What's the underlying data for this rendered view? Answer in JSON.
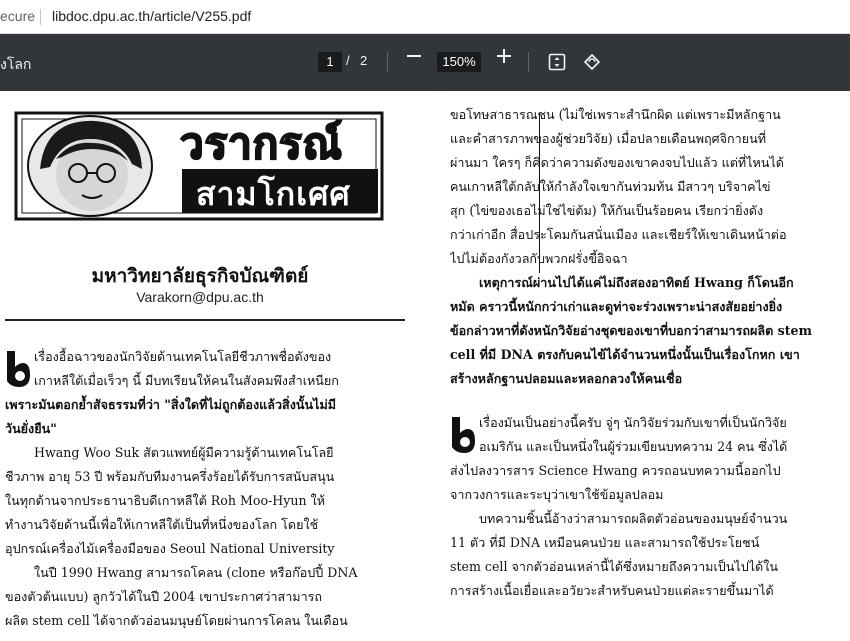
{
  "browser": {
    "secure_label": "ecure",
    "url": "libdoc.dpu.ac.th/article/V255.pdf"
  },
  "toolbar": {
    "title": "งโลก",
    "current_page": "1",
    "page_separator": "/",
    "total_pages": "2",
    "zoom": "150%",
    "icons": [
      "minus-icon",
      "plus-icon",
      "fit-page-icon",
      "rotate-icon"
    ]
  },
  "article": {
    "logo_line1": "วรากรณ์",
    "logo_line2": "สามโกเศศ",
    "university": "มหาวิทยาลัยธุรกิจบัณฑิตย์",
    "email": "Varakorn@dpu.ac.th",
    "left_column": [
      "เรื่องอื้อฉาวของนักวิจัยด้านเทคโนโลยีชีวภาพชื่อดังของ",
      "เกาหลีใต้เมื่อเร็วๆ นี้ มีบทเรียนให้คนในสังคมพึงสำเหนียก",
      "เพราะมันตอกย้ำสัจธรรมที่ว่า \"สิ่งใดที่ไม่ถูกต้องแล้วสิ่งนั้นไม่มี",
      "วันยั่งยืน\"",
      "Hwang Woo Suk สัตวแพทย์ผู้มีความรู้ด้านเทคโนโลยี",
      "ชีวภาพ อายุ 53 ปี พร้อมกับทีมงานครึ่งร้อยได้รับการสนับสนุน",
      "ในทุกด้านจากประธานาธิบดีเกาหลีใต้ Roh Moo-Hyun ให้",
      "ทำงานวิจัยด้านนี้เพื่อให้เกาหลีใต้เป็นที่หนึ่งของโลก โดยใช้",
      "อุปกรณ์เครื่องไม้เครื่องมือของ Seoul National University",
      "ในปี 1990 Hwang สามารถโคลน (clone หรือก๊อปปี้ DNA",
      "ของตัวต้นแบบ) ลูกวัวได้ในปี 2004 เขาประกาศว่าสามารถ",
      "ผลิต stem cell ได้จากตัวอ่อนมนุษย์โดยผ่านการโคลน ในเดือน"
    ],
    "right_column": [
      "ขอโทษสาธารณชน (ไม่ใช่เพราะสำนึกผิด แต่เพราะมีหลักฐาน",
      "และคำสารภาพของผู้ช่วยวิจัย) เมื่อปลายเดือนพฤศจิกายนที่",
      "ผ่านมา ใครๆ ก็คิดว่าความดังของเขาคงจบไปแล้ว แต่ที่ไหนได้",
      "คนเกาหลีใต้กลับให้กำลังใจเขากันท่วมท้น มีสาวๆ บริจาคไข่",
      "สุก (ไข่ของเธอไม่ใช่ไข่ต้ม) ให้กันเป็นร้อยคน เรียกว่ายิ่งดัง",
      "กว่าเก่าอีก สื่อประโคมกันสนั่นเมือง และเชียร์ให้เขาเดินหน้าต่อ",
      "ไปไม่ต้องกังวลกับพวกฝรั่งขี้อิจฉา",
      "เหตุการณ์ผ่านไปได้แค่ไม่ถึงสองอาทิตย์ Hwang ก็โดนอีก",
      "หมัด คราวนี้หนักกว่าเก่าและดูท่าจะร่วงเพราะน่าสงสัยอย่างยิ่ง",
      "ข้อกล่าวหาที่ดังหนักวิจัยอ่างชุดของเขาที่บอกว่าสามารถผลิต stem",
      "cell ที่มี DNA ตรงกับคนไข้ได้จำนวนหนึ่งนั้นเป็นเรื่องโกหก เขา",
      "สร้างหลักฐานปลอมและหลอกลวงให้คนเชื่อ",
      "เรื่องมันเป็นอย่างนี้ครับ จู่ๆ นักวิจัยร่วมกับเขาที่เป็นนักวิจัย",
      "อเมริกัน และเป็นหนึ่งในผู้ร่วมเขียนบทความ 24 คน ซึ่งได้",
      "ส่งไปลงวารสาร Science Hwang ควรถอนบทความนี้ออกไป",
      "จากวงการและระบุว่าเขาใช้ข้อมูลปลอม",
      "บทความชิ้นนี้อ้างว่าสามารถผลิตตัวอ่อนของมนุษย์จำนวน",
      "11 ตัว ที่มี DNA เหมือนคนป่วย และสามารถใช้ประโยชน์",
      "stem cell จากตัวอ่อนเหล่านี้ได้ซึ่งหมายถึงความเป็นไปได้ใน",
      "การสร้างเนื้อเยื่อและอวัยวะสำหรับคนป่วยแต่ละรายขึ้นมาได้"
    ]
  }
}
